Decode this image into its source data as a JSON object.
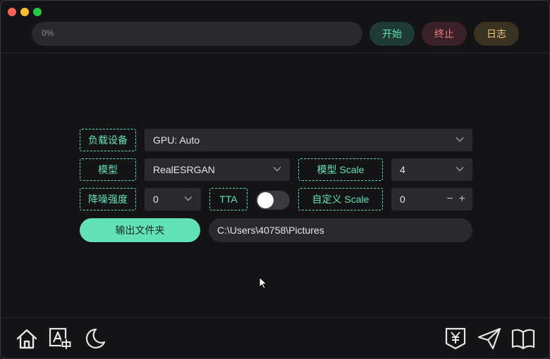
{
  "toolbar": {
    "progress_value": 0,
    "progress_text": "0%",
    "start_label": "开始",
    "stop_label": "终止",
    "log_label": "日志"
  },
  "form": {
    "device_label": "负载设备",
    "device_value": "GPU: Auto",
    "model_label": "模型",
    "model_value": "RealESRGAN",
    "model_scale_label": "模型 Scale",
    "model_scale_value": "4",
    "denoise_label": "降噪强度",
    "denoise_value": "0",
    "tta_label": "TTA",
    "tta_enabled": false,
    "custom_scale_label": "自定义 Scale",
    "custom_scale_value": "0",
    "output_button_label": "输出文件夹",
    "output_path": "C:\\Users\\40758\\Pictures"
  },
  "bottom_icons": {
    "left": [
      "home-icon",
      "translate-icon",
      "moon-icon"
    ],
    "right": [
      "yen-donate-icon",
      "send-icon",
      "book-icon"
    ]
  },
  "colors": {
    "accent": "#63e2b7",
    "danger": "#e88080",
    "warning": "#f2c97d"
  }
}
